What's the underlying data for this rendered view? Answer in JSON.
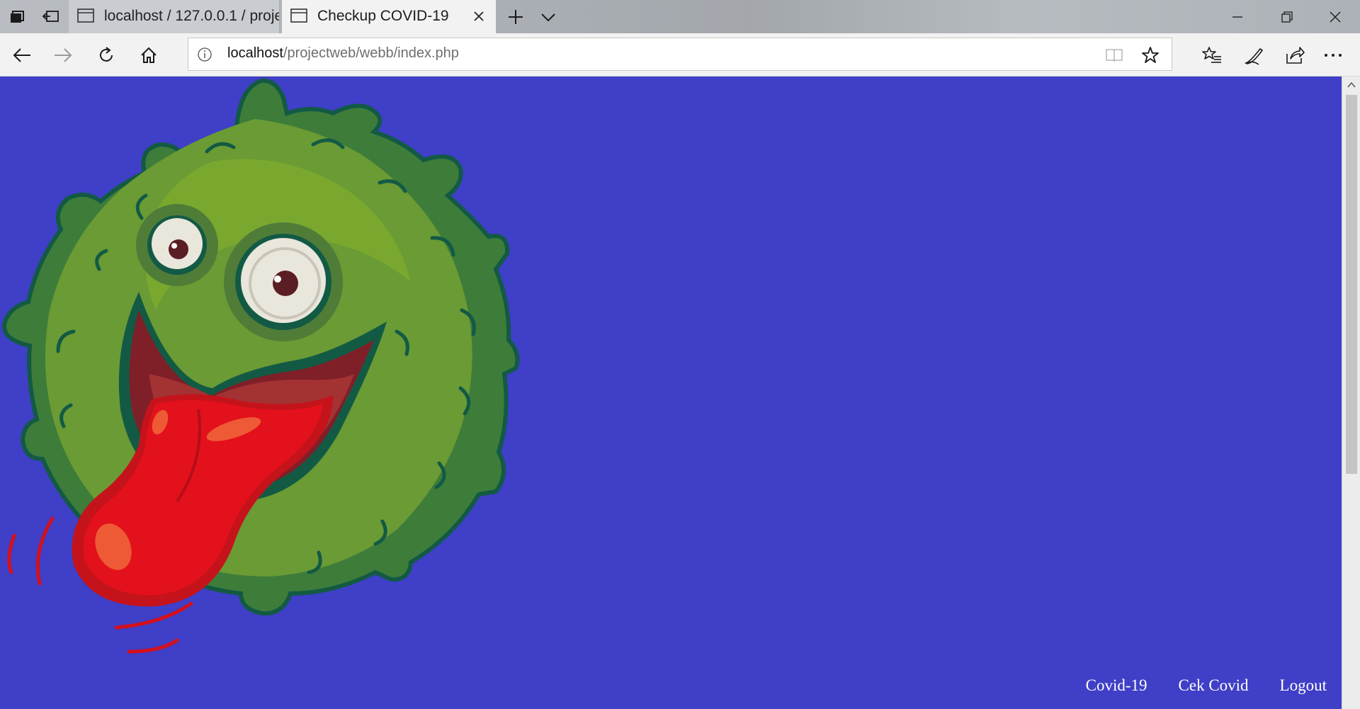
{
  "browser": {
    "tabs": [
      {
        "title": "localhost / 127.0.0.1 / proje",
        "active": false
      },
      {
        "title": "Checkup COVID-19",
        "active": true
      }
    ],
    "address": {
      "host": "localhost",
      "path": "/projectweb/webb/index.php"
    },
    "icons": {
      "tab_actions": "tab-actions-icon",
      "set_aside": "set-aside-tabs-icon",
      "new_tab": "plus-icon",
      "tab_preview": "chevron-down-icon",
      "minimize": "minimize-icon",
      "restore": "restore-icon",
      "close": "close-icon",
      "back": "back-arrow-icon",
      "forward": "forward-arrow-icon",
      "refresh": "refresh-icon",
      "home": "home-icon",
      "site_info": "info-icon",
      "reading_view": "book-icon",
      "favorite": "star-icon",
      "favorites_hub": "favorites-list-icon",
      "web_note": "pen-icon",
      "share": "share-icon",
      "more": "ellipsis-icon"
    }
  },
  "page": {
    "background": "#3f3fc7",
    "nav": [
      {
        "label": "Covid-19"
      },
      {
        "label": "Cek Covid"
      },
      {
        "label": "Logout"
      }
    ],
    "illustration": "covid-virus-mascot"
  }
}
